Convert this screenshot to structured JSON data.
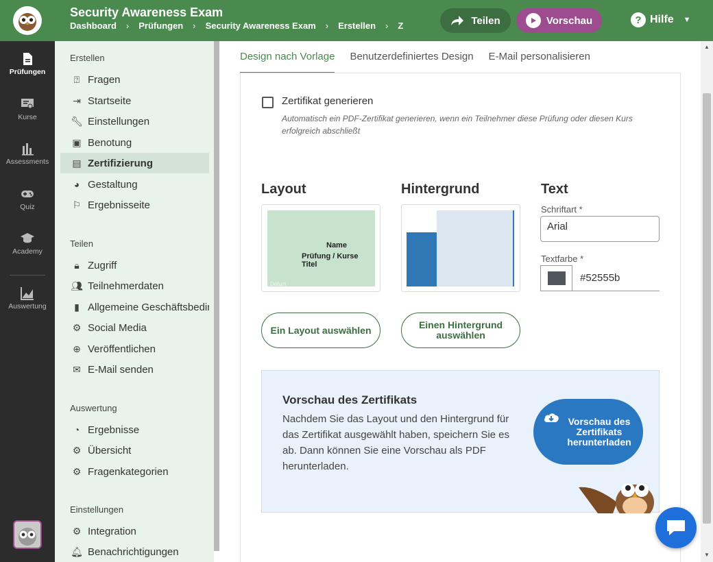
{
  "header": {
    "title": "Security Awareness Exam",
    "breadcrumbs": [
      "Dashboard",
      "Prüfungen",
      "Security Awareness Exam",
      "Erstellen",
      "Ze"
    ],
    "share_label": "Teilen",
    "preview_label": "Vorschau",
    "help_label": "Hilfe",
    "help_icon_char": "?"
  },
  "rail": {
    "items": [
      {
        "label": "Prüfungen",
        "icon": "document-icon"
      },
      {
        "label": "Kurse",
        "icon": "certificate-icon"
      },
      {
        "label": "Assessments",
        "icon": "bar-chart-icon"
      },
      {
        "label": "Quiz",
        "icon": "gamepad-icon"
      },
      {
        "label": "Academy",
        "icon": "graduation-cap-icon"
      },
      {
        "label": "Auswertung",
        "icon": "line-chart-icon"
      }
    ]
  },
  "sidebar": {
    "sections": [
      {
        "heading": "Erstellen",
        "items": [
          {
            "label": "Fragen",
            "icon": "question-icon"
          },
          {
            "label": "Startseite",
            "icon": "enter-icon"
          },
          {
            "label": "Einstellungen",
            "icon": "wrench-icon"
          },
          {
            "label": "Benotung",
            "icon": "clipboard-icon"
          },
          {
            "label": "Zertifizierung",
            "icon": "certificate-icon"
          },
          {
            "label": "Gestaltung",
            "icon": "palette-icon"
          },
          {
            "label": "Ergebnisseite",
            "icon": "flag-icon"
          }
        ]
      },
      {
        "heading": "Teilen",
        "items": [
          {
            "label": "Zugriff",
            "icon": "lock-icon"
          },
          {
            "label": "Teilnehmerdaten",
            "icon": "people-icon"
          },
          {
            "label": "Allgemeine Geschäftsbedingungen",
            "icon": "document-icon"
          },
          {
            "label": "Social Media",
            "icon": "gear-icon"
          },
          {
            "label": "Veröffentlichen",
            "icon": "globe-icon"
          },
          {
            "label": "E-Mail senden",
            "icon": "mail-icon"
          }
        ]
      },
      {
        "heading": "Auswertung",
        "items": [
          {
            "label": "Ergebnisse",
            "icon": "pie-icon"
          },
          {
            "label": "Übersicht",
            "icon": "gear-icon"
          },
          {
            "label": "Fragenkategorien",
            "icon": "gear-icon"
          }
        ]
      },
      {
        "heading": "Einstellungen",
        "items": [
          {
            "label": "Integration",
            "icon": "gear-icon"
          },
          {
            "label": "Benachrichtigungen",
            "icon": "bell-icon"
          }
        ]
      }
    ]
  },
  "tabs": [
    "Design nach Vorlage",
    "Benutzerdefiniertes Design",
    "E-Mail personalisieren"
  ],
  "certificate": {
    "checkbox_label": "Zertifikat generieren",
    "checkbox_help": "Automatisch ein PDF-Zertifikat generieren, wenn ein Teilnehmer diese Prüfung oder diesen Kurs erfolgreich abschließt",
    "layout_title": "Layout",
    "layout_preview_name": "Name",
    "layout_preview_subtitle": "Prüfung / Kurse Titel",
    "layout_preview_date": "Datum",
    "background_title": "Hintergrund",
    "text_title": "Text",
    "font_label": "Schriftart *",
    "font_value": "Arial",
    "color_label": "Textfarbe *",
    "color_value": "#52555b",
    "select_layout_button": "Ein Layout auswählen",
    "select_background_button": "Einen Hintergrund auswählen"
  },
  "preview": {
    "title": "Vorschau des Zertifikats",
    "text": "Nachdem Sie das Layout und den Hintergrund für das Zertifikat ausgewählt haben, speichern Sie es ab. Dann können Sie eine Vorschau als PDF herunterladen.",
    "download_button": "Vorschau des Zertifikats herunterladen"
  },
  "colors": {
    "primary_green": "#4a8a4f",
    "preview_purple": "#9c4c8f",
    "download_blue": "#2b78c2",
    "text_color_swatch": "#52555b"
  }
}
